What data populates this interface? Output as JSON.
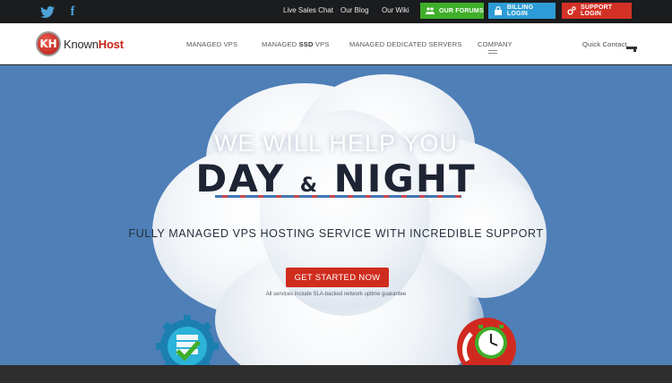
{
  "topbar": {
    "social": [
      {
        "icon": "twitter-icon"
      },
      {
        "icon": "facebook-icon",
        "glyph": "f"
      }
    ],
    "links": {
      "chat": "Live Sales Chat",
      "blog": "Our Blog",
      "wiki": "Our Wiki"
    },
    "buttons": {
      "forums": "OUR FORUMS",
      "billing": "BILLING LOGIN",
      "support": "SUPPORT LOGIN"
    },
    "colors": {
      "forums": "#3fae2a",
      "billing": "#2d9cd6",
      "support": "#d43126"
    }
  },
  "nav": {
    "logo": {
      "badge": "KH",
      "known": "Known",
      "host": "Host"
    },
    "items": {
      "vps": "MANAGED VPS",
      "ssd_pre": "MANAGED ",
      "ssd_bold": "SSD",
      "ssd_post": " VPS",
      "dedicated": "MANAGED DEDICATED SERVERS",
      "company": "COMPANY"
    },
    "quick_contact": "Quick Contact"
  },
  "hero": {
    "line1": "WE WILL HELP YOU",
    "line2_a": "DAY",
    "line2_amp": "&",
    "line2_b": "NIGHT",
    "subtitle": "FULLY MANAGED VPS HOSTING SERVICE WITH INCREDIBLE SUPPORT",
    "cta": "GET STARTED NOW",
    "disclaimer": "All services include SLA-backed network uptime guarantee",
    "accent": "#cf2c1e",
    "background": "#4f7fb7"
  },
  "badges": [
    {
      "icon": "server-check-icon"
    },
    {
      "icon": "clock-icon"
    }
  ]
}
